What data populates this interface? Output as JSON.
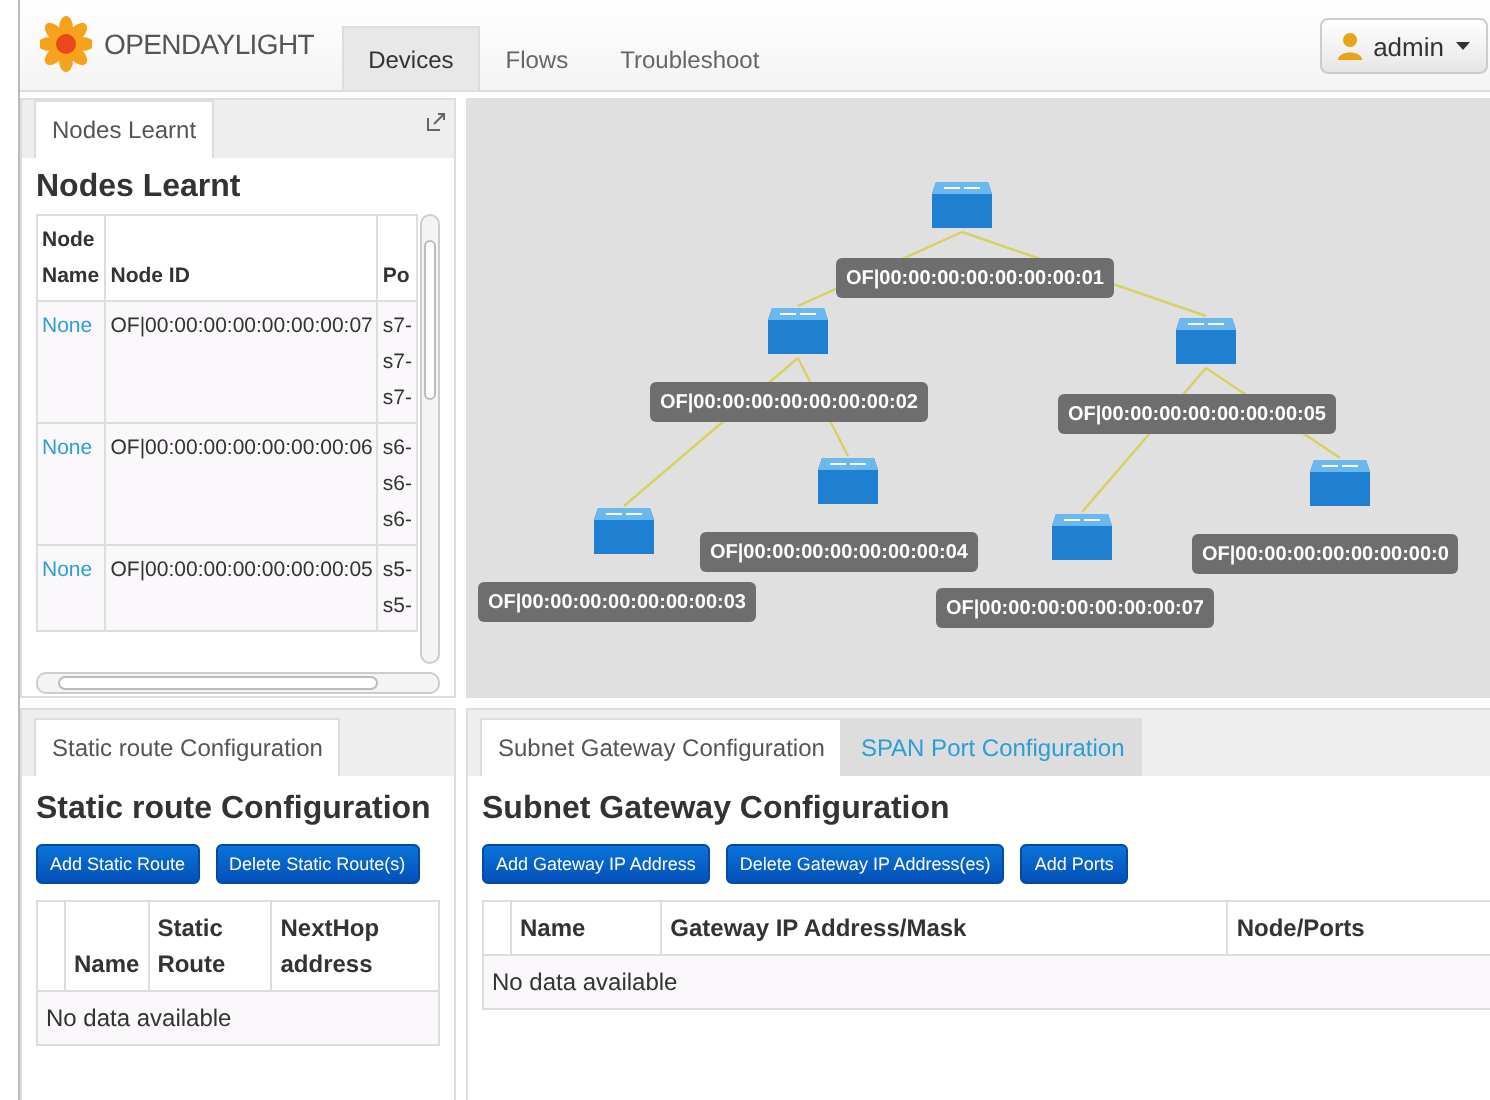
{
  "header": {
    "logo": "OPENDAYLIGHT",
    "tabs": [
      {
        "label": "Devices",
        "selected": true
      },
      {
        "label": "Flows",
        "selected": false
      },
      {
        "label": "Troubleshoot",
        "selected": false
      }
    ],
    "user": "admin"
  },
  "nodes_panel": {
    "tabs": [
      {
        "label": "Nodes Learnt",
        "selected": true
      }
    ],
    "title": "Nodes Learnt",
    "columns": [
      "Node Name",
      "Node ID",
      "Po"
    ],
    "rows": [
      {
        "name": "None",
        "id": "OF|00:00:00:00:00:00:00:07",
        "ports": [
          "s7-",
          "s7-",
          "s7-"
        ]
      },
      {
        "name": "None",
        "id": "OF|00:00:00:00:00:00:00:06",
        "ports": [
          "s6-",
          "s6-",
          "s6-"
        ]
      },
      {
        "name": "None",
        "id": "OF|00:00:00:00:00:00:00:05",
        "ports": [
          "s5-",
          "s5-"
        ]
      }
    ]
  },
  "topology": {
    "nodes": [
      {
        "label": "OF|00:00:00:00:00:00:00:01"
      },
      {
        "label": "OF|00:00:00:00:00:00:00:02"
      },
      {
        "label": "OF|00:00:00:00:00:00:00:05"
      },
      {
        "label": "OF|00:00:00:00:00:00:00:04"
      },
      {
        "label": "OF|00:00:00:00:00:00:00:03"
      },
      {
        "label": "OF|00:00:00:00:00:00:00:07"
      },
      {
        "label": "OF|00:00:00:00:00:00:00:0"
      }
    ]
  },
  "static_panel": {
    "tabs": [
      {
        "label": "Static route Configuration",
        "selected": true
      }
    ],
    "title": "Static route Configuration",
    "buttons": [
      "Add Static Route",
      "Delete Static Route(s)"
    ],
    "columns": [
      "Name",
      "Static Route",
      "NextHop address"
    ],
    "empty": "No data available"
  },
  "gateway_panel": {
    "tabs": [
      {
        "label": "Subnet Gateway Configuration",
        "selected": true
      },
      {
        "label": "SPAN Port Configuration",
        "selected": false
      }
    ],
    "title": "Subnet Gateway Configuration",
    "buttons": [
      "Add Gateway IP Address",
      "Delete Gateway IP Address(es)",
      "Add Ports"
    ],
    "columns": [
      "Name",
      "Gateway IP Address/Mask",
      "Node/Ports"
    ],
    "empty": "No data available"
  }
}
